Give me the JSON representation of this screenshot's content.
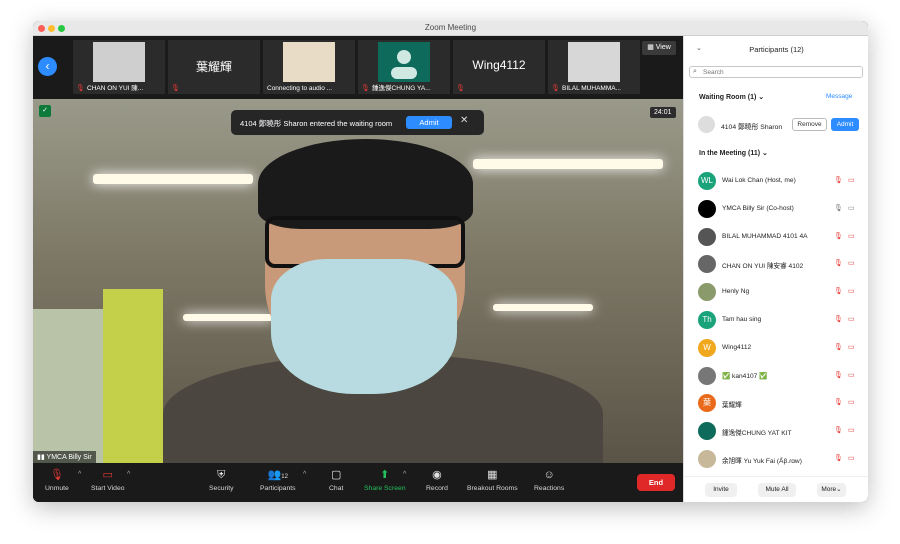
{
  "window": {
    "title": "Zoom Meeting"
  },
  "strip": {
    "view_label": "View",
    "tiles": [
      {
        "label": "CHAN ON YUI 陳...",
        "type": "photo"
      },
      {
        "label": "",
        "big": "葉耀輝",
        "type": "text"
      },
      {
        "label": "Connecting to audio ...",
        "type": "photo"
      },
      {
        "label": "鍾逸傑CHUNG YA...",
        "type": "avatar"
      },
      {
        "label": "",
        "big": "Wing4112",
        "type": "text"
      },
      {
        "label": "BILAL MUHAMMA...",
        "type": "photo"
      }
    ]
  },
  "video": {
    "timer": "24:01",
    "speaker_name": "YMCA Billy Sir",
    "toast": {
      "message": "4104 鄭曉彤 Sharon entered the waiting room",
      "admit_label": "Admit",
      "close": "✕"
    }
  },
  "toolbar": {
    "unmute": "Unmute",
    "start_video": "Start Video",
    "security": "Security",
    "participants": "Participants",
    "participants_count": "12",
    "chat": "Chat",
    "share_screen": "Share Screen",
    "record": "Record",
    "breakout": "Breakout Rooms",
    "reactions": "Reactions",
    "end": "End"
  },
  "panel": {
    "title": "Participants (12)",
    "search_placeholder": "Search",
    "waiting_header": "Waiting Room (1)",
    "message_link": "Message",
    "waiting": [
      {
        "name": "4104 鄭曉彤 Sharon",
        "remove_label": "Remove",
        "admit_label": "Admit"
      }
    ],
    "meeting_header": "In the Meeting (11)",
    "participants": [
      {
        "name": "Wai Lok Chan (Host, me)",
        "initials": "WL",
        "color": "#1aa37a",
        "mic": "off",
        "cam": "off"
      },
      {
        "name": "YMCA Billy Sir (Co-host)",
        "initials": "",
        "color": "#000000",
        "mic": "on",
        "cam": "on"
      },
      {
        "name": "BILAL MUHAMMAD 4101 4A",
        "initials": "",
        "color": "#555555",
        "mic": "off",
        "cam": "off"
      },
      {
        "name": "CHAN ON YUI 陳安睿 4102",
        "initials": "",
        "color": "#666666",
        "mic": "off",
        "cam": "off"
      },
      {
        "name": "Henly Ng",
        "initials": "",
        "color": "#8a9a6a",
        "mic": "off",
        "cam": "off"
      },
      {
        "name": "Tam hau sing",
        "initials": "Th",
        "color": "#1aa37a",
        "mic": "off",
        "cam": "off"
      },
      {
        "name": "Wing4112",
        "initials": "W",
        "color": "#f0a81c",
        "mic": "off",
        "cam": "off"
      },
      {
        "name": "✅ kan4107 ✅",
        "initials": "",
        "color": "#777777",
        "mic": "off",
        "cam": "off"
      },
      {
        "name": "葉耀輝",
        "initials": "葉",
        "color": "#e86a1a",
        "mic": "off",
        "cam": "off"
      },
      {
        "name": "鍾逸傑CHUNG YAT KIT",
        "initials": "",
        "color": "#0e6b5b",
        "mic": "off",
        "cam": "off"
      },
      {
        "name": "余旭暉 Yu Yuk Fai (Ấβ.ɾɑw)",
        "initials": "",
        "color": "#c7b89a",
        "mic": "off",
        "cam": "off"
      }
    ],
    "invite": "Invite",
    "mute_all": "Mute All",
    "more": "More"
  }
}
